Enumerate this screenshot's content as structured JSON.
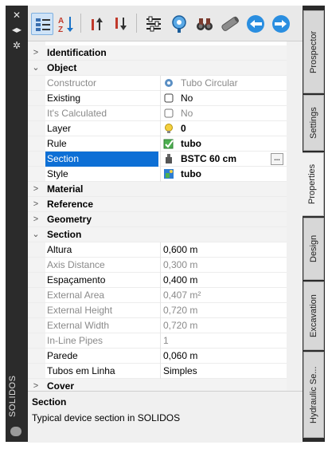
{
  "palette_title": "SOLIDOS",
  "toolbar": {
    "buttons": [
      {
        "name": "categorized-view"
      },
      {
        "name": "alphabetic-sort"
      },
      {
        "name": "move-up"
      },
      {
        "name": "move-down"
      },
      {
        "name": "properties-settings"
      },
      {
        "name": "pick-object"
      },
      {
        "name": "binoculars-find"
      },
      {
        "name": "pipe"
      },
      {
        "name": "swap-left"
      },
      {
        "name": "swap-right"
      }
    ]
  },
  "grid": {
    "identification": "Identification",
    "object": "Object",
    "constructor_label": "Constructor",
    "constructor_value": "Tubo Circular",
    "existing_label": "Existing",
    "existing_value": "No",
    "calculated_label": "It's Calculated",
    "calculated_value": "No",
    "layer_label": "Layer",
    "layer_value": "0",
    "rule_label": "Rule",
    "rule_value": "tubo",
    "section_label": "Section",
    "section_value": "BSTC 60 cm",
    "section_button": "...",
    "style_label": "Style",
    "style_value": "tubo",
    "material": "Material",
    "reference": "Reference",
    "geometry": "Geometry",
    "section_cat": "Section",
    "altura_label": "Altura",
    "altura_value": "0,600 m",
    "axis_label": "Axis Distance",
    "axis_value": "0,300 m",
    "esp_label": "Espaçamento",
    "esp_value": "0,400 m",
    "extarea_label": "External Area",
    "extarea_value": "0,407 m²",
    "extheight_label": "External Height",
    "extheight_value": "0,720 m",
    "extwidth_label": "External Width",
    "extwidth_value": "0,720 m",
    "inline_label": "In-Line Pipes",
    "inline_value": "1",
    "parede_label": "Parede",
    "parede_value": "0,060 m",
    "tubos_label": "Tubos em Linha",
    "tubos_value": "Simples",
    "cover": "Cover"
  },
  "description": {
    "title": "Section",
    "text": "Typical device section in SOLIDOS"
  },
  "tabs": [
    "Prospector",
    "Settings",
    "Properties",
    "Design",
    "Excavation",
    "Hydraulic Se..."
  ],
  "active_tab": "Properties",
  "colors": {
    "selection": "#0d6fd5",
    "frame": "#2b2b2b",
    "accent": "#1a73c8"
  }
}
